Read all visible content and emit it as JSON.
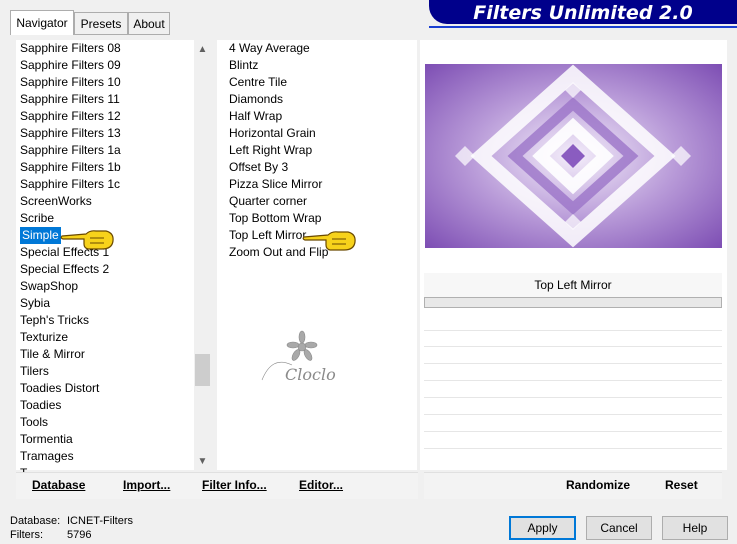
{
  "tabs": [
    "Navigator",
    "Presets",
    "About"
  ],
  "banner_title": "Filters Unlimited 2.0",
  "categories": [
    "Sapphire Filters 08",
    "Sapphire Filters 09",
    "Sapphire Filters 10",
    "Sapphire Filters 11",
    "Sapphire Filters 12",
    "Sapphire Filters 13",
    "Sapphire Filters 1a",
    "Sapphire Filters 1b",
    "Sapphire Filters 1c",
    "ScreenWorks",
    "Scribe",
    "Simple",
    "Special Effects 1",
    "Special Effects 2",
    "SwapShop",
    "Sybia",
    "Teph's Tricks",
    "Texturize",
    "Tile & Mirror",
    "Tilers",
    "Toadies Distort",
    "Toadies",
    "Tools",
    "Tormentia",
    "Tramages",
    "T"
  ],
  "selected_category": "Simple",
  "filters": [
    "4 Way Average",
    "Blintz",
    "Centre Tile",
    "Diamonds",
    "Half Wrap",
    "Horizontal Grain",
    "Left Right Wrap",
    "Offset By 3",
    "Pizza Slice Mirror",
    "Quarter corner",
    "Top Bottom Wrap",
    "Top Left Mirror",
    "Zoom Out and Flip"
  ],
  "selected_filter": "Top Left Mirror",
  "preview_label": "Top Left Mirror",
  "watermark": "Cloclo",
  "buttons": {
    "database": "Database",
    "import": "Import...",
    "filter_info": "Filter Info...",
    "editor": "Editor...",
    "randomize": "Randomize",
    "reset": "Reset",
    "apply": "Apply",
    "cancel": "Cancel",
    "help": "Help"
  },
  "status": {
    "database_label": "Database:",
    "database_value": "ICNET-Filters",
    "filters_label": "Filters:",
    "filters_value": "5796"
  },
  "colors": {
    "banner": "#00008b",
    "selection": "#0078d7",
    "preview_purple": "#8a5cc0"
  }
}
